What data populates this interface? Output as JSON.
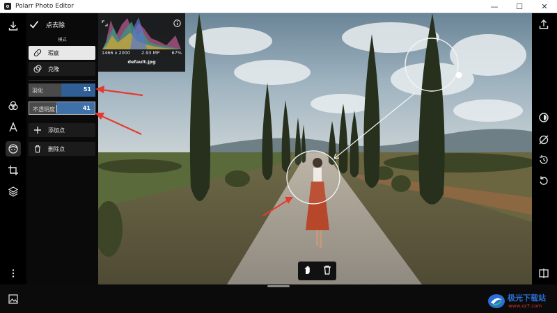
{
  "window": {
    "title": "Polarr Photo Editor",
    "minimize": "—",
    "maximize": "☐",
    "close": "✕"
  },
  "left_rail": {
    "icons": [
      "download-icon",
      "filters-icon",
      "text-icon",
      "face-retouch-icon",
      "crop-icon",
      "layers-icon",
      "more-icon"
    ],
    "active": "face-retouch-icon"
  },
  "panel": {
    "confirm_label": "点去除",
    "mode_label": "模式",
    "modes": [
      {
        "label": "瑕疵",
        "selected": true
      },
      {
        "label": "克隆",
        "selected": false
      }
    ],
    "sliders": {
      "feather": {
        "label": "羽化",
        "value": "51",
        "fraction": 0.51
      },
      "opacity": {
        "label": "不透明度",
        "value": "41",
        "fraction": 0.41
      }
    },
    "add_point_label": "添加点",
    "delete_point_label": "删除点"
  },
  "histogram": {
    "dimensions": "1466 x 2000",
    "megapixels": "2.93 MP",
    "zoom": "67%",
    "filename": "default.jpg"
  },
  "right_rail": {
    "icons": [
      "export-icon",
      "compare-split-icon",
      "hide-edits-icon",
      "history-timer-icon",
      "reset-icon",
      "side-by-side-icon"
    ]
  },
  "watermark": {
    "title": "极光下载站",
    "url": "www.xz7.com"
  },
  "colors": {
    "accent": "#2f5f95",
    "annotation": "#e63a2e"
  }
}
